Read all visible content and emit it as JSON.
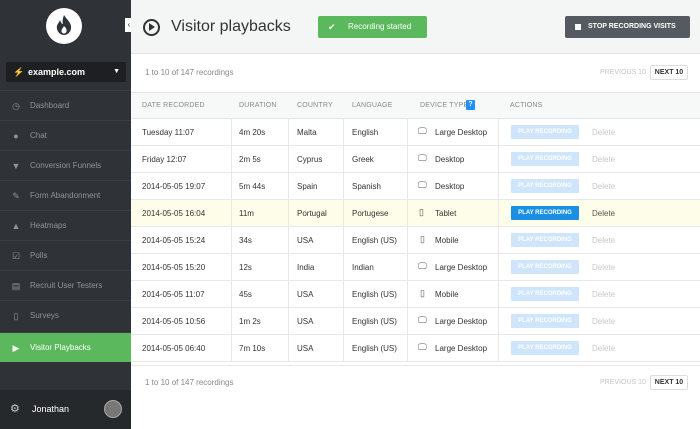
{
  "sidebar": {
    "site": "example.com",
    "collapse_glyph": "‹",
    "items": [
      {
        "label": "Dashboard",
        "icon": "dashboard-icon",
        "glyph": "◷"
      },
      {
        "label": "Chat",
        "icon": "chat-icon",
        "glyph": "●"
      },
      {
        "label": "Conversion Funnels",
        "icon": "funnel-icon",
        "glyph": "▼"
      },
      {
        "label": "Form Abandonment",
        "icon": "edit-icon",
        "glyph": "✎"
      },
      {
        "label": "Heatmaps",
        "icon": "heatmap-icon",
        "glyph": "▲"
      },
      {
        "label": "Polls",
        "icon": "checkbox-icon",
        "glyph": "☑"
      },
      {
        "label": "Recruit User Testers",
        "icon": "id-card-icon",
        "glyph": "▤"
      },
      {
        "label": "Surveys",
        "icon": "survey-icon",
        "glyph": "▯"
      },
      {
        "label": "Visitor Playbacks",
        "icon": "play-icon",
        "glyph": "▶",
        "active": true
      }
    ],
    "user": "Jonathan"
  },
  "header": {
    "title": "Visitor playbacks",
    "recording_started": "Recording started",
    "stop_button": "STOP RECORDING VISITS"
  },
  "pagination": {
    "summary": "1 to 10 of 147 recordings",
    "previous": "PREVIOUS 10",
    "next": "NEXT 10"
  },
  "table": {
    "columns": [
      "DATE RECORDED",
      "DURATION",
      "COUNTRY",
      "LANGUAGE",
      "DEVICE TYPE",
      "ACTIONS"
    ],
    "help_badge": "?",
    "play_label": "PLAY RECORDING",
    "delete_label": "Delete",
    "rows": [
      {
        "date": "Tuesday 11:07",
        "duration": "4m 20s",
        "country": "Malta",
        "language": "English",
        "device": "Large Desktop",
        "device_icon": "monitor-icon"
      },
      {
        "date": "Friday 12:07",
        "duration": "2m 5s",
        "country": "Cyprus",
        "language": "Greek",
        "device": "Desktop",
        "device_icon": "monitor-icon"
      },
      {
        "date": "2014-05-05 19:07",
        "duration": "5m 44s",
        "country": "Spain",
        "language": "Spanish",
        "device": "Desktop",
        "device_icon": "monitor-icon"
      },
      {
        "date": "2014-05-05 16:04",
        "duration": "11m",
        "country": "Portugal",
        "language": "Portugese",
        "device": "Tablet",
        "device_icon": "tablet-icon",
        "selected": true
      },
      {
        "date": "2014-05-05 15:24",
        "duration": "34s",
        "country": "USA",
        "language": "English (US)",
        "device": "Mobile",
        "device_icon": "phone-icon"
      },
      {
        "date": "2014-05-05 15:20",
        "duration": "12s",
        "country": "India",
        "language": "Indian",
        "device": "Large Desktop",
        "device_icon": "monitor-icon"
      },
      {
        "date": "2014-05-05 11:07",
        "duration": "45s",
        "country": "USA",
        "language": "English (US)",
        "device": "Mobile",
        "device_icon": "phone-icon"
      },
      {
        "date": "2014-05-05 10:56",
        "duration": "1m 2s",
        "country": "USA",
        "language": "English (US)",
        "device": "Large Desktop",
        "device_icon": "monitor-icon"
      },
      {
        "date": "2014-05-05 06:40",
        "duration": "7m 10s",
        "country": "USA",
        "language": "English (US)",
        "device": "Large Desktop",
        "device_icon": "monitor-icon"
      }
    ]
  },
  "colors": {
    "accent_green": "#5cb85c",
    "sidebar_bg": "#2f3236",
    "play_active": "#1a8fe3",
    "play_inactive": "#cfe5fb"
  }
}
